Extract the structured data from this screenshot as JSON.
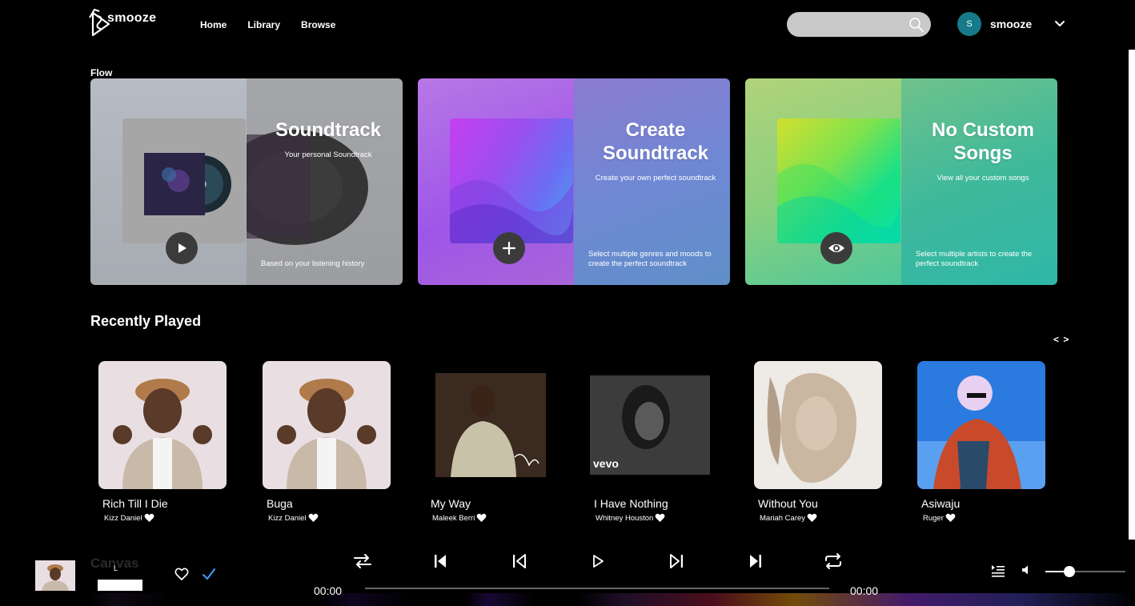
{
  "app": {
    "logo_text": "smooze"
  },
  "nav": {
    "items": [
      "Home",
      "Library",
      "Browse"
    ]
  },
  "search": {
    "placeholder": ""
  },
  "user": {
    "initial": "S",
    "name": "smooze"
  },
  "flow": {
    "label": "Flow",
    "cards": [
      {
        "title": "Soundtrack",
        "subtitle": "Your personal Soundtrack",
        "footer": "Based on your listening history",
        "button_icon": "play-icon"
      },
      {
        "title": "Create Soundtrack",
        "subtitle": "Create your own perfect soundtrack",
        "footer": "Select multiple genres and moods to create the perfect soundtrack",
        "button_icon": "plus-icon"
      },
      {
        "title": "No Custom Songs",
        "subtitle": "View all your custom songs",
        "footer": "Select multiple artists to create the perfect soundtrack",
        "button_icon": "eye-icon"
      }
    ]
  },
  "recently_played": {
    "title": "Recently Played",
    "prev_label": "<",
    "next_label": ">",
    "songs": [
      {
        "name": "Rich Till I Die",
        "artist": "Kizz Daniel"
      },
      {
        "name": "Buga",
        "artist": "Kizz Daniel"
      },
      {
        "name": "My Way",
        "artist": "Maleek Berri"
      },
      {
        "name": "I Have Nothing",
        "artist": "Whitney Houston"
      },
      {
        "name": "Without You",
        "artist": "Mariah Carey"
      },
      {
        "name": "Asiwaju",
        "artist": "Ruger"
      }
    ]
  },
  "player": {
    "now_playing_title": "Canvas",
    "now_playing_mini": "L",
    "current_time": "00:00",
    "total_time": "00:00",
    "progress": 0,
    "volume": 0.3,
    "controls": [
      "shuffle-icon",
      "skip-back-icon",
      "previous-icon",
      "play-icon",
      "next-icon",
      "skip-forward-icon",
      "repeat-icon"
    ]
  },
  "colors": {
    "accent": "#177a8a",
    "check": "#3aa0ff",
    "background": "#000000"
  }
}
